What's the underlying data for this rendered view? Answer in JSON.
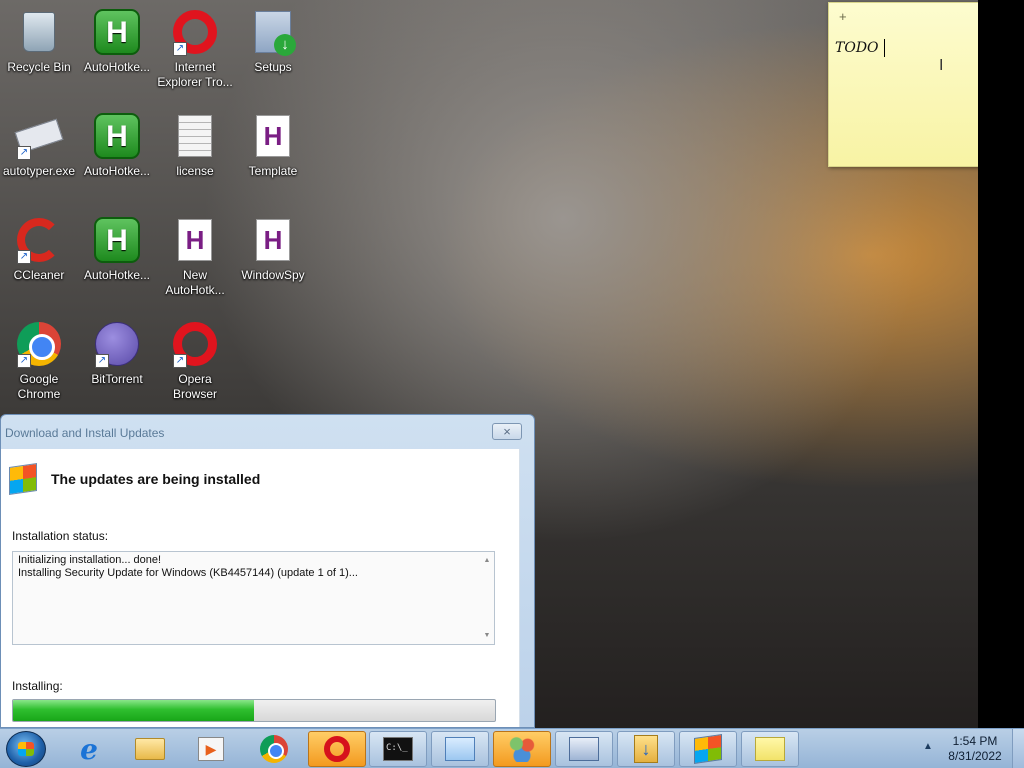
{
  "desktop": {
    "icons": [
      {
        "label": "Recycle Bin",
        "icon": "recycle-bin-icon"
      },
      {
        "label": "AutoHotke...",
        "icon": "autohotkey-icon"
      },
      {
        "label": "Internet Explorer Tro...",
        "icon": "opera-icon"
      },
      {
        "label": "Setups",
        "icon": "installer-icon"
      },
      {
        "label": "autotyper.exe",
        "icon": "keyboard-icon"
      },
      {
        "label": "AutoHotke...",
        "icon": "autohotkey-icon"
      },
      {
        "label": "license",
        "icon": "text-document-icon"
      },
      {
        "label": "Template",
        "icon": "ahk-script-icon"
      },
      {
        "label": "CCleaner",
        "icon": "ccleaner-icon"
      },
      {
        "label": "AutoHotke...",
        "icon": "autohotkey-icon"
      },
      {
        "label": "New AutoHotk...",
        "icon": "ahk-script-icon"
      },
      {
        "label": "WindowSpy",
        "icon": "ahk-script-icon"
      },
      {
        "label": "Google Chrome",
        "icon": "chrome-icon"
      },
      {
        "label": "BitTorrent",
        "icon": "bittorrent-icon"
      },
      {
        "label": "Opera Browser",
        "icon": "opera-icon"
      }
    ]
  },
  "sticky_note": {
    "add_symbol": "+",
    "close_symbol": "×",
    "text": "TODO"
  },
  "dialog": {
    "title": "Download and Install Updates",
    "close_symbol": "×",
    "heading": "The updates are being installed",
    "status_label": "Installation status:",
    "log_lines": [
      "Initializing installation... done!",
      "Installing Security Update for Windows (KB4457144) (update 1 of 1)..."
    ],
    "installing_label": "Installing:",
    "progress": 0.5
  },
  "taskbar": {
    "buttons": [
      {
        "name": "internet-explorer",
        "icon": "internet-explorer-icon"
      },
      {
        "name": "windows-explorer",
        "icon": "folder-icon"
      },
      {
        "name": "media-player",
        "icon": "media-player-icon"
      },
      {
        "name": "google-chrome",
        "icon": "chrome-icon"
      },
      {
        "name": "opera",
        "icon": "opera-icon",
        "active": true
      },
      {
        "name": "command-prompt",
        "icon": "command-prompt-icon"
      },
      {
        "name": "resource-monitor",
        "icon": "monitor-icon"
      },
      {
        "name": "user-accounts",
        "icon": "users-icon"
      },
      {
        "name": "remote-desktop",
        "icon": "remote-desktop-icon"
      },
      {
        "name": "downloads",
        "icon": "download-folder-icon"
      },
      {
        "name": "windows-update",
        "icon": "windows-update-icon"
      },
      {
        "name": "sticky-notes",
        "icon": "sticky-notes-icon"
      }
    ],
    "clock_time": "1:54 PM",
    "clock_date": "8/31/2022",
    "cmd_text": "C:\\_"
  },
  "colors": {
    "sticky_note": "#f8f3a4",
    "progress_fill": "#2fbf2f",
    "taskbar": "#a9c2de",
    "active_taskbar_button": "#f39a1f"
  }
}
